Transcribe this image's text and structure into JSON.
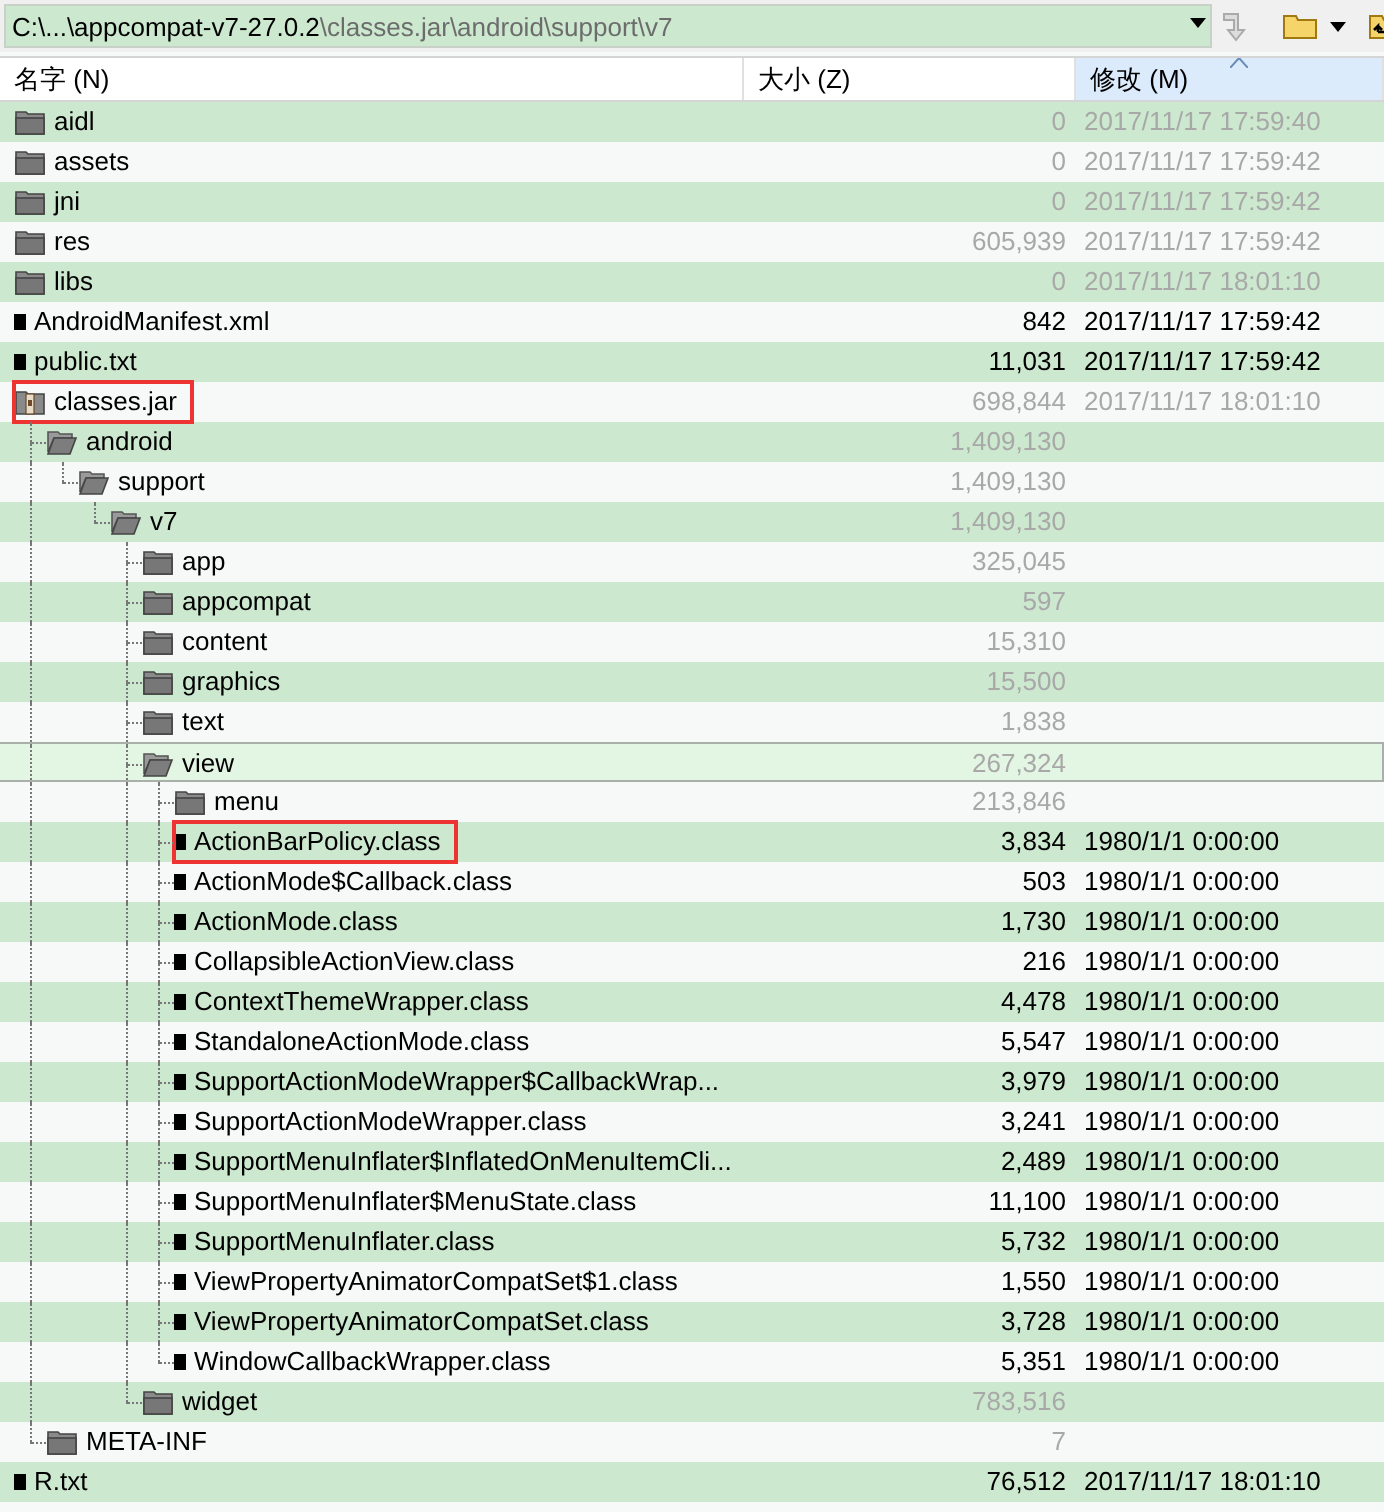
{
  "address_bar": {
    "path_head": "C:\\...\\appcompat-v7-27.0.2",
    "path_tail": "\\classes.jar\\android\\support\\v7"
  },
  "columns": [
    {
      "label": "名字 (N)",
      "sorted": false
    },
    {
      "label": "大小 (Z)",
      "sorted": false
    },
    {
      "label": "修改 (M)",
      "sorted": true
    }
  ],
  "files": [
    {
      "kind": "folder",
      "name": "aidl",
      "size": "0",
      "modified": "2017/11/17 17:59:40",
      "selected": false,
      "boxed": false
    },
    {
      "kind": "folder",
      "name": "assets",
      "size": "0",
      "modified": "2017/11/17 17:59:42",
      "selected": false,
      "boxed": false
    },
    {
      "kind": "folder",
      "name": "jni",
      "size": "0",
      "modified": "2017/11/17 17:59:42",
      "selected": false,
      "boxed": false
    },
    {
      "kind": "folder",
      "name": "res",
      "size": "605,939",
      "modified": "2017/11/17 17:59:42",
      "selected": false,
      "boxed": false
    },
    {
      "kind": "folder",
      "name": "libs",
      "size": "0",
      "modified": "2017/11/17 18:01:10",
      "selected": false,
      "boxed": false
    },
    {
      "kind": "file",
      "name": "AndroidManifest.xml",
      "size": "842",
      "modified": "2017/11/17 17:59:42",
      "selected": false,
      "boxed": false
    },
    {
      "kind": "file",
      "name": "public.txt",
      "size": "11,031",
      "modified": "2017/11/17 17:59:42",
      "selected": false,
      "boxed": false
    },
    {
      "kind": "archive",
      "name": "classes.jar",
      "size": "698,844",
      "modified": "2017/11/17 18:01:10",
      "selected": false,
      "boxed": true,
      "children": [
        {
          "kind": "folder",
          "name": "android",
          "size": "1,409,130",
          "selected": false,
          "boxed": false,
          "children": [
            {
              "kind": "folder",
              "name": "support",
              "size": "1,409,130",
              "selected": false,
              "boxed": false,
              "children": [
                {
                  "kind": "folder",
                  "name": "v7",
                  "size": "1,409,130",
                  "selected": false,
                  "boxed": false,
                  "children": [
                    {
                      "kind": "folder",
                      "name": "app",
                      "size": "325,045",
                      "selected": false,
                      "boxed": false
                    },
                    {
                      "kind": "folder",
                      "name": "appcompat",
                      "size": "597",
                      "selected": false,
                      "boxed": false
                    },
                    {
                      "kind": "folder",
                      "name": "content",
                      "size": "15,310",
                      "selected": false,
                      "boxed": false
                    },
                    {
                      "kind": "folder",
                      "name": "graphics",
                      "size": "15,500",
                      "selected": false,
                      "boxed": false
                    },
                    {
                      "kind": "folder",
                      "name": "text",
                      "size": "1,838",
                      "selected": false,
                      "boxed": false
                    },
                    {
                      "kind": "folder",
                      "name": "view",
                      "size": "267,324",
                      "selected": true,
                      "boxed": false,
                      "children": [
                        {
                          "kind": "folder",
                          "name": "menu",
                          "size": "213,846",
                          "selected": false,
                          "boxed": false
                        },
                        {
                          "kind": "file",
                          "name": "ActionBarPolicy.class",
                          "size": "3,834",
                          "modified": "1980/1/1 0:00:00",
                          "selected": false,
                          "boxed": true
                        },
                        {
                          "kind": "file",
                          "name": "ActionMode$Callback.class",
                          "size": "503",
                          "modified": "1980/1/1 0:00:00",
                          "selected": false,
                          "boxed": false
                        },
                        {
                          "kind": "file",
                          "name": "ActionMode.class",
                          "size": "1,730",
                          "modified": "1980/1/1 0:00:00",
                          "selected": false,
                          "boxed": false
                        },
                        {
                          "kind": "file",
                          "name": "CollapsibleActionView.class",
                          "size": "216",
                          "modified": "1980/1/1 0:00:00",
                          "selected": false,
                          "boxed": false
                        },
                        {
                          "kind": "file",
                          "name": "ContextThemeWrapper.class",
                          "size": "4,478",
                          "modified": "1980/1/1 0:00:00",
                          "selected": false,
                          "boxed": false
                        },
                        {
                          "kind": "file",
                          "name": "StandaloneActionMode.class",
                          "size": "5,547",
                          "modified": "1980/1/1 0:00:00",
                          "selected": false,
                          "boxed": false
                        },
                        {
                          "kind": "file",
                          "name": "SupportActionModeWrapper$CallbackWrap...",
                          "size": "3,979",
                          "modified": "1980/1/1 0:00:00",
                          "selected": false,
                          "boxed": false
                        },
                        {
                          "kind": "file",
                          "name": "SupportActionModeWrapper.class",
                          "size": "3,241",
                          "modified": "1980/1/1 0:00:00",
                          "selected": false,
                          "boxed": false
                        },
                        {
                          "kind": "file",
                          "name": "SupportMenuInflater$InflatedOnMenuItemCli...",
                          "size": "2,489",
                          "modified": "1980/1/1 0:00:00",
                          "selected": false,
                          "boxed": false
                        },
                        {
                          "kind": "file",
                          "name": "SupportMenuInflater$MenuState.class",
                          "size": "11,100",
                          "modified": "1980/1/1 0:00:00",
                          "selected": false,
                          "boxed": false
                        },
                        {
                          "kind": "file",
                          "name": "SupportMenuInflater.class",
                          "size": "5,732",
                          "modified": "1980/1/1 0:00:00",
                          "selected": false,
                          "boxed": false
                        },
                        {
                          "kind": "file",
                          "name": "ViewPropertyAnimatorCompatSet$1.class",
                          "size": "1,550",
                          "modified": "1980/1/1 0:00:00",
                          "selected": false,
                          "boxed": false
                        },
                        {
                          "kind": "file",
                          "name": "ViewPropertyAnimatorCompatSet.class",
                          "size": "3,728",
                          "modified": "1980/1/1 0:00:00",
                          "selected": false,
                          "boxed": false
                        },
                        {
                          "kind": "file",
                          "name": "WindowCallbackWrapper.class",
                          "size": "5,351",
                          "modified": "1980/1/1 0:00:00",
                          "selected": false,
                          "boxed": false
                        }
                      ]
                    },
                    {
                      "kind": "folder",
                      "name": "widget",
                      "size": "783,516",
                      "selected": false,
                      "boxed": false
                    }
                  ]
                }
              ]
            }
          ]
        },
        {
          "kind": "folder",
          "name": "META-INF",
          "size": "7",
          "selected": false,
          "boxed": false
        }
      ]
    },
    {
      "kind": "file",
      "name": "R.txt",
      "size": "76,512",
      "modified": "2017/11/17 18:01:10",
      "selected": false,
      "boxed": false
    }
  ]
}
